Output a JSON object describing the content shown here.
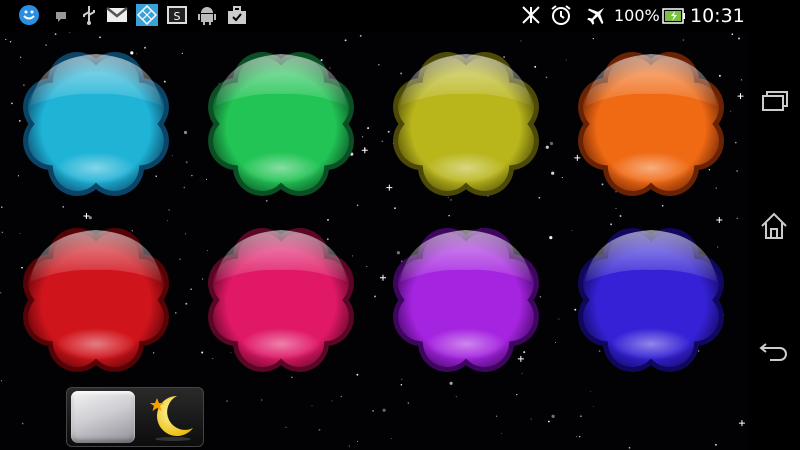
{
  "status_bar": {
    "notification_icons": [
      "blue-app-icon",
      "message-icon",
      "usb-icon",
      "gmail-icon",
      "grid-app-icon",
      "sd-card-icon",
      "android-icon",
      "briefcase-icon"
    ],
    "system_icons": [
      "nfc-icon",
      "alarm-clock-icon",
      "airplane-mode-icon"
    ],
    "battery_percent": "100%",
    "battery_level": 1.0,
    "clock": "10:31"
  },
  "bubbles": [
    {
      "id": "cyan",
      "color": "#1fb3d6",
      "dark": "#0a4466"
    },
    {
      "id": "green",
      "color": "#22c455",
      "dark": "#0b4f24"
    },
    {
      "id": "yellow",
      "color": "#b9b61c",
      "dark": "#4d4a07"
    },
    {
      "id": "orange",
      "color": "#f06a14",
      "dark": "#6a2204"
    },
    {
      "id": "red",
      "color": "#d0141c",
      "dark": "#550306"
    },
    {
      "id": "pink",
      "color": "#e01866",
      "dark": "#5a0625"
    },
    {
      "id": "purple",
      "color": "#a524e0",
      "dark": "#3f0660"
    },
    {
      "id": "blue",
      "color": "#3522d6",
      "dark": "#10085c"
    }
  ],
  "mode_toggle": {
    "day_icon": "square-icon",
    "night_icon": "moon-star-icon"
  },
  "nav_bar": {
    "buttons": [
      "recent-apps-icon",
      "home-icon",
      "back-icon"
    ]
  }
}
